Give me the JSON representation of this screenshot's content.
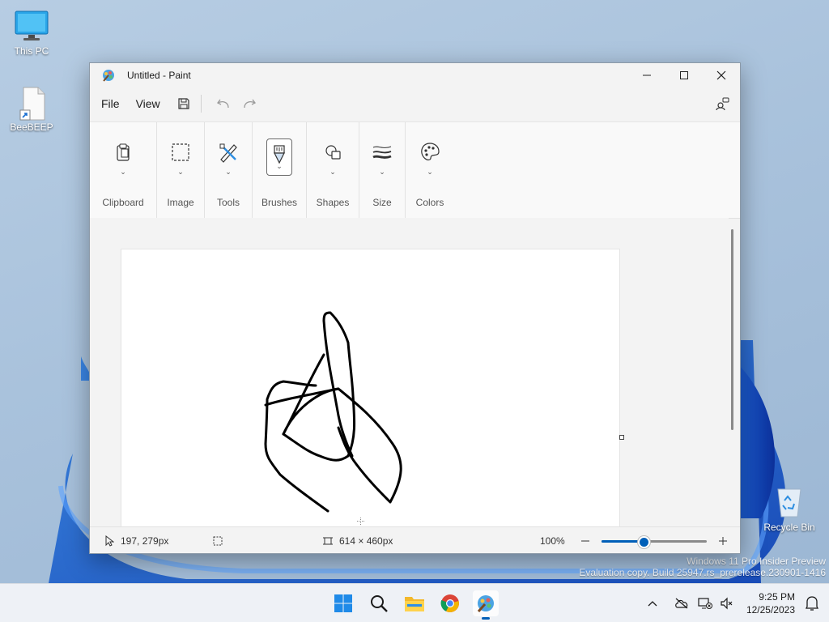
{
  "desktop": {
    "icons": [
      {
        "label": "This PC"
      },
      {
        "label": "BeeBEEP"
      },
      {
        "label": "Recycle Bin"
      }
    ],
    "watermark": {
      "line1": "Windows 11 Pro Insider Preview",
      "line2": "Evaluation copy. Build 25947.rs_prerelease.230901-1416"
    }
  },
  "window": {
    "title": "Untitled - Paint",
    "menu": {
      "file": "File",
      "view": "View"
    },
    "ribbon": {
      "groups": [
        {
          "label": "Clipboard",
          "icon": "clipboard-icon"
        },
        {
          "label": "Image",
          "icon": "selection-icon"
        },
        {
          "label": "Tools",
          "icon": "tools-icon"
        },
        {
          "label": "Brushes",
          "icon": "brush-icon",
          "active": true
        },
        {
          "label": "Shapes",
          "icon": "shapes-icon"
        },
        {
          "label": "Size",
          "icon": "size-icon"
        },
        {
          "label": "Colors",
          "icon": "palette-icon"
        }
      ]
    },
    "status": {
      "cursor_position": "197, 279px",
      "canvas_size": "614 × 460px",
      "zoom": "100%",
      "zoom_level_fraction": 0.39
    }
  },
  "taskbar": {
    "apps": [
      "start-icon",
      "search-icon",
      "file-explorer-icon",
      "chrome-icon",
      "paint-icon"
    ],
    "clock": {
      "time": "9:25 PM",
      "date": "12/25/2023"
    }
  },
  "colors": {
    "accent": "#005fb8",
    "stroke": "#000000"
  }
}
